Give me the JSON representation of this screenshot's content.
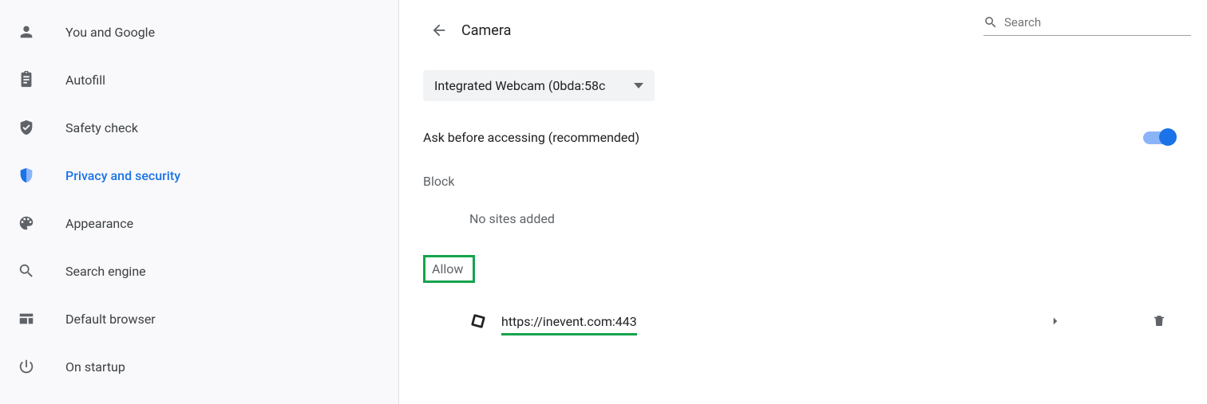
{
  "sidebar": {
    "items": [
      {
        "label": "You and Google",
        "icon": "person-icon",
        "active": false
      },
      {
        "label": "Autofill",
        "icon": "clipboard-icon",
        "active": false
      },
      {
        "label": "Safety check",
        "icon": "shield-check-icon",
        "active": false
      },
      {
        "label": "Privacy and security",
        "icon": "shield-icon",
        "active": true
      },
      {
        "label": "Appearance",
        "icon": "palette-icon",
        "active": false
      },
      {
        "label": "Search engine",
        "icon": "search-icon",
        "active": false
      },
      {
        "label": "Default browser",
        "icon": "browser-icon",
        "active": false
      },
      {
        "label": "On startup",
        "icon": "power-icon",
        "active": false
      }
    ]
  },
  "header": {
    "title": "Camera",
    "search_placeholder": "Search"
  },
  "camera": {
    "selected_device": "Integrated Webcam (0bda:58c",
    "ask_label": "Ask before accessing (recommended)",
    "toggle_on": true,
    "block_heading": "Block",
    "block_empty": "No sites added",
    "allow_heading": "Allow",
    "allow_sites": [
      {
        "url": "https://inevent.com:443"
      }
    ]
  }
}
